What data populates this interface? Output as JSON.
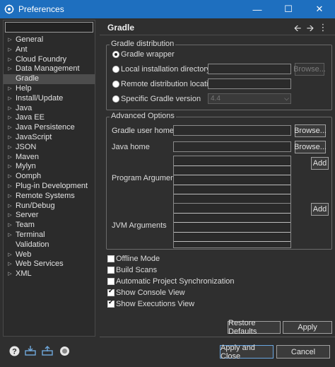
{
  "window": {
    "title": "Preferences",
    "minimize_glyph": "—",
    "maximize_glyph": "☐",
    "close_glyph": "✕"
  },
  "sidebar": {
    "filter_value": "",
    "items": [
      {
        "label": "General",
        "expandable": true
      },
      {
        "label": "Ant",
        "expandable": true
      },
      {
        "label": "Cloud Foundry",
        "expandable": true
      },
      {
        "label": "Data Management",
        "expandable": true
      },
      {
        "label": "Gradle",
        "expandable": false,
        "selected": true
      },
      {
        "label": "Help",
        "expandable": true
      },
      {
        "label": "Install/Update",
        "expandable": true
      },
      {
        "label": "Java",
        "expandable": true
      },
      {
        "label": "Java EE",
        "expandable": true
      },
      {
        "label": "Java Persistence",
        "expandable": true
      },
      {
        "label": "JavaScript",
        "expandable": true
      },
      {
        "label": "JSON",
        "expandable": true
      },
      {
        "label": "Maven",
        "expandable": true
      },
      {
        "label": "Mylyn",
        "expandable": true
      },
      {
        "label": "Oomph",
        "expandable": true
      },
      {
        "label": "Plug-in Development",
        "expandable": true
      },
      {
        "label": "Remote Systems",
        "expandable": true
      },
      {
        "label": "Run/Debug",
        "expandable": true
      },
      {
        "label": "Server",
        "expandable": true
      },
      {
        "label": "Team",
        "expandable": true
      },
      {
        "label": "Terminal",
        "expandable": true
      },
      {
        "label": "Validation",
        "expandable": false
      },
      {
        "label": "Web",
        "expandable": true
      },
      {
        "label": "Web Services",
        "expandable": true
      },
      {
        "label": "XML",
        "expandable": true
      }
    ]
  },
  "page": {
    "title": "Gradle",
    "nav_back": "🡨",
    "nav_forward": "🡪",
    "nav_menu": "⋮"
  },
  "distribution": {
    "legend": "Gradle distribution",
    "wrapper_label": "Gradle wrapper",
    "local_label": "Local installation directory",
    "local_browse": "Browse...",
    "remote_label": "Remote distribution location",
    "specific_label": "Specific Gradle version",
    "specific_value": "4.4"
  },
  "advanced": {
    "legend": "Advanced Options",
    "user_home_label": "Gradle user home",
    "user_home_browse": "Browse...",
    "java_home_label": "Java home",
    "java_home_browse": "Browse...",
    "program_args_label": "Program Arguments",
    "program_args_add": "Add",
    "jvm_args_label": "JVM Arguments",
    "jvm_args_add": "Add"
  },
  "options": [
    {
      "label": "Offline Mode",
      "checked": false
    },
    {
      "label": "Build Scans",
      "checked": false
    },
    {
      "label": "Automatic Project Synchronization",
      "checked": false
    },
    {
      "label": "Show Console View",
      "checked": true
    },
    {
      "label": "Show Executions View",
      "checked": true
    }
  ],
  "buttons": {
    "restore_defaults": "Restore Defaults",
    "apply": "Apply",
    "apply_and_close": "Apply and Close",
    "cancel": "Cancel"
  },
  "colors": {
    "titlebar": "#1e6fbf",
    "background": "#2f2f2f"
  }
}
